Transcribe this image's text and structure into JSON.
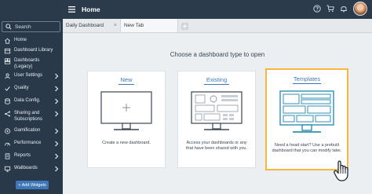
{
  "header": {
    "title": "Home"
  },
  "tabs": [
    {
      "label": "Daily Dashboard"
    },
    {
      "label": "New Tab"
    }
  ],
  "sidebar": {
    "search_label": "Search",
    "items": [
      {
        "label": "Home",
        "icon": "home-icon"
      },
      {
        "label": "Dashboard Library",
        "icon": "library-icon"
      },
      {
        "label": "Dashboards (Legacy)",
        "icon": "dashboard-icon"
      },
      {
        "label": "User Settings",
        "icon": "user-icon"
      },
      {
        "label": "Quality",
        "icon": "check-icon"
      },
      {
        "label": "Data Config.",
        "icon": "database-icon"
      },
      {
        "label": "Sharing and Subscriptions",
        "icon": "share-icon"
      },
      {
        "label": "Gamification",
        "icon": "gamification-icon"
      },
      {
        "label": "Performance",
        "icon": "performance-icon"
      },
      {
        "label": "Reports",
        "icon": "reports-icon"
      },
      {
        "label": "Wallboards",
        "icon": "wallboard-icon"
      }
    ],
    "add_widgets_label": "+ Add Widgets"
  },
  "main": {
    "prompt": "Choose a dashboard type to open",
    "cards": [
      {
        "title": "New",
        "description": "Create a new dashboard."
      },
      {
        "title": "Existing",
        "description": "Access your dashboards or any that have been shared with you."
      },
      {
        "title": "Templates",
        "description": "Need a head start? Use a prebuilt dashboard that you can modify later."
      }
    ]
  },
  "colors": {
    "accent": "#3f78b8",
    "highlight": "#f6b73c",
    "sidebar": "#29394a"
  }
}
